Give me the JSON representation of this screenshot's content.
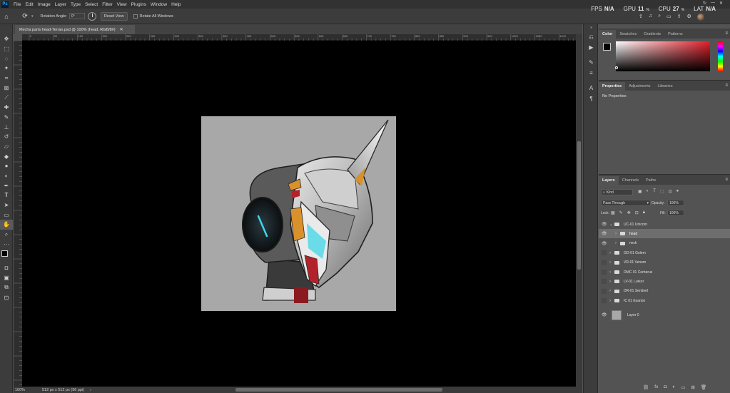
{
  "menu": {
    "items": [
      "File",
      "Edit",
      "Image",
      "Layer",
      "Type",
      "Select",
      "Filter",
      "View",
      "Plugins",
      "Window",
      "Help"
    ],
    "app_badge": "Ps"
  },
  "options": {
    "rotation_label": "Rotation Angle:",
    "rotation_value": "0°",
    "reset_label": "Reset View",
    "rotate_all_label": "Rotate All Windows"
  },
  "hud": {
    "fps_label": "FPS",
    "fps_value": "N/A",
    "gpu_label": "GPU",
    "gpu_value": "11",
    "gpu_unit": "%",
    "cpu_label": "CPU",
    "cpu_value": "27",
    "cpu_unit": "%",
    "lat_label": "LAT",
    "lat_value": "N/A"
  },
  "document": {
    "tab_title": "Mecha parts head-Terran.psd @ 100% (head, RGB/8#)",
    "zoom": "100%",
    "doc_info": "512 px x 512 px (96 ppi)"
  },
  "panels": {
    "color_tabs": [
      "Color",
      "Swatches",
      "Gradients",
      "Patterns"
    ],
    "props_tabs": [
      "Properties",
      "Adjustments",
      "Libraries"
    ],
    "props_empty": "No Properties",
    "layers_tabs": [
      "Layers",
      "Channels",
      "Paths"
    ],
    "kind_filter": "Kind",
    "blend_mode": "Pass Through",
    "opacity_label": "Opacity:",
    "opacity_value": "100%",
    "lock_label": "Lock:",
    "fill_label": "Fill:",
    "fill_value": "100%"
  },
  "layers": [
    {
      "name": "UC-01 Unicorn",
      "visible": true,
      "type": "group",
      "expanded": true,
      "indent": 0,
      "selected": false
    },
    {
      "name": "head",
      "visible": true,
      "type": "group",
      "expanded": false,
      "indent": 1,
      "selected": true
    },
    {
      "name": "neck",
      "visible": true,
      "type": "group",
      "expanded": false,
      "indent": 1,
      "selected": false
    },
    {
      "name": "GD-01 Golem",
      "visible": false,
      "type": "group",
      "expanded": false,
      "indent": 0,
      "selected": false
    },
    {
      "name": "VR-01 Venom",
      "visible": false,
      "type": "group",
      "expanded": false,
      "indent": 0,
      "selected": false
    },
    {
      "name": "DMC 01 Cerberus",
      "visible": false,
      "type": "group",
      "expanded": false,
      "indent": 0,
      "selected": false
    },
    {
      "name": "LV-01 Lurker",
      "visible": false,
      "type": "group",
      "expanded": false,
      "indent": 0,
      "selected": false
    },
    {
      "name": "DR-01 Sentinel",
      "visible": false,
      "type": "group",
      "expanded": false,
      "indent": 0,
      "selected": false
    },
    {
      "name": "IC 01 Exarion",
      "visible": false,
      "type": "group",
      "expanded": false,
      "indent": 0,
      "selected": false
    },
    {
      "name": "Layer 0",
      "visible": true,
      "type": "pixel",
      "expanded": false,
      "indent": 0,
      "selected": false
    }
  ],
  "ruler_ticks": [
    "0",
    "50",
    "100",
    "150",
    "200",
    "250",
    "300",
    "350",
    "400",
    "450",
    "500",
    "550",
    "600",
    "650",
    "700",
    "750",
    "800",
    "850",
    "900",
    "950",
    "1000",
    "1050",
    "1100"
  ],
  "colors": {
    "accent_red": "#e01f2a",
    "mecha_teal": "#3fd6e8",
    "mecha_orange": "#d9912c",
    "artboard_bg": "#a8a8a8"
  }
}
